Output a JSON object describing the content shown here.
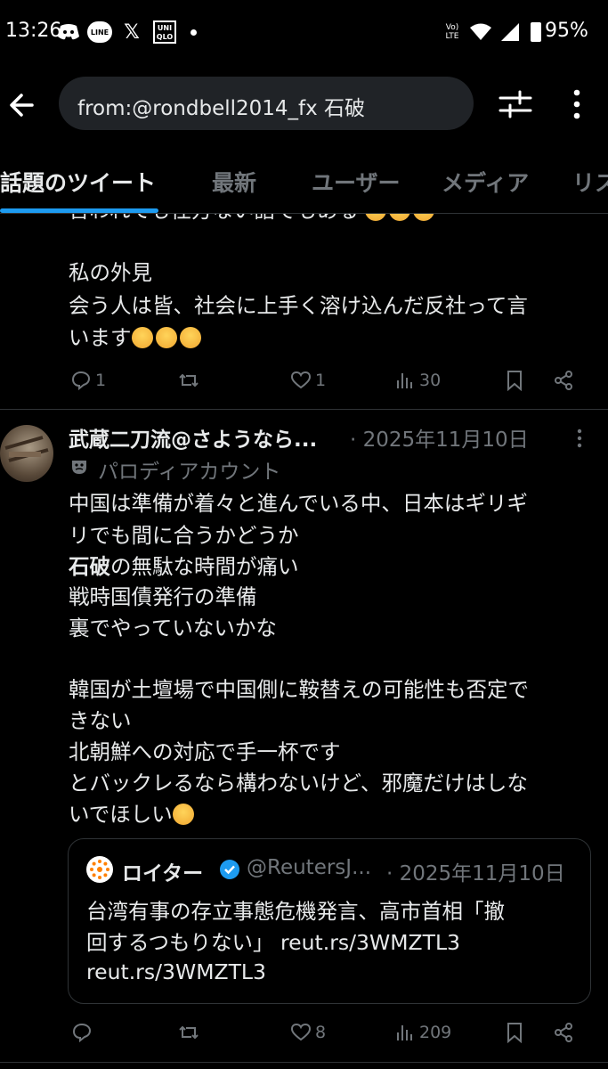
{
  "status_bar": {
    "time": "13:26",
    "battery": "95%",
    "net_label": "Vo) LTE",
    "icons": [
      "discord-icon",
      "line-icon",
      "x-icon",
      "uniqlo-icon",
      "dot-icon",
      "wifi-icon",
      "signal-icon",
      "battery-icon"
    ],
    "line_label": "LINE",
    "uniqlo_label": "UNI QLO"
  },
  "header": {
    "search_query": "from:@rondbell2014_fx 石破"
  },
  "tabs": [
    {
      "label": "話題のツイート",
      "active": true
    },
    {
      "label": "最新",
      "active": false
    },
    {
      "label": "ユーザー",
      "active": false
    },
    {
      "label": "メディア",
      "active": false
    },
    {
      "label": "リス",
      "active": false
    }
  ],
  "tweet1": {
    "cut_line": "言われても仕方ない話でもある",
    "lines": [
      "私の外見",
      "会う人は皆、社会に上手く溶け込んだ反社って言",
      "います"
    ],
    "actions": {
      "replies": "1",
      "retweets": "",
      "likes": "1",
      "views": "30"
    }
  },
  "tweet2": {
    "author": "武蔵二刀流@さようなら...",
    "date": "· 2025年11月10日",
    "badge": "パロディアカウント",
    "lines": [
      "中国は準備が着々と進んでいる中、日本はギリギ",
      "リでも間に合うかどうか"
    ],
    "bold_word": "石破",
    "line3_rest": "の無駄な時間が痛い",
    "lines2": [
      "戦時国債発行の準備",
      "裏でやっていないかな"
    ],
    "lines3": [
      "韓国が土壇場で中国側に鞍替えの可能性も否定で",
      "きない",
      "北朝鮮への対応で手一杯です",
      "とバックレるなら構わないけど、邪魔だけはしな",
      "いでほしい"
    ],
    "quote": {
      "name": "ロイター",
      "handle": "@ReutersJ...",
      "date": "· 2025年11月10日",
      "lines": [
        "台湾有事の存立事態危機発言、高市首相「撤",
        "回するつもりない」 reut.rs/3WMZTL3",
        "reut.rs/3WMZTL3"
      ]
    },
    "actions": {
      "replies": "",
      "retweets": "",
      "likes": "8",
      "views": "209"
    }
  },
  "colors": {
    "background": "#000000",
    "accent": "#1d9bf0",
    "muted": "#71767b",
    "text": "#e7e9ea"
  }
}
